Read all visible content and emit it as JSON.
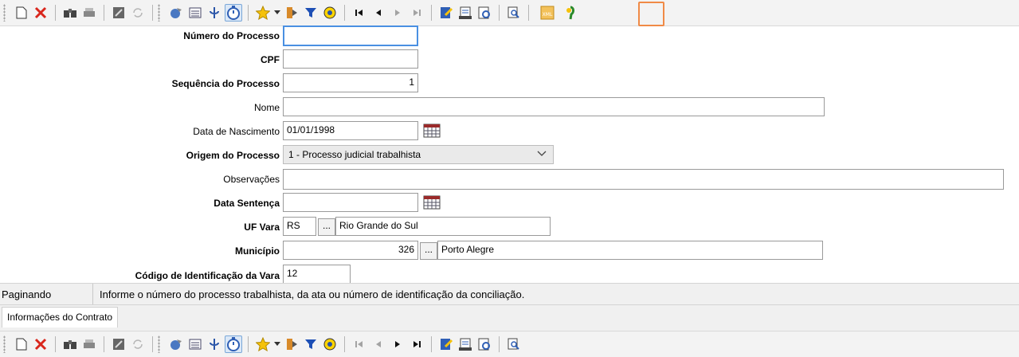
{
  "toolbar_top": {
    "icons": [
      "new-icon",
      "delete-icon",
      "find-icon",
      "print-icon",
      "save-icon",
      "refresh-icon",
      "assistant-icon",
      "list-icon",
      "info-icon",
      "timer-icon",
      "favorites-icon",
      "dropdown-arrow-icon",
      "export-icon",
      "filter-icon",
      "help-icon",
      "first-icon",
      "prev-icon",
      "next-icon",
      "last-icon",
      "edit-icon",
      "report-icon",
      "preview-icon",
      "zoom-icon",
      "xml-icon",
      "tree-icon"
    ],
    "xml_label": "XML"
  },
  "form": {
    "fields": {
      "numero_processo": {
        "label": "Número do Processo",
        "value": ""
      },
      "cpf": {
        "label": "CPF",
        "value": ""
      },
      "sequencia": {
        "label": "Sequência do Processo",
        "value": "1"
      },
      "nome": {
        "label": "Nome",
        "value": ""
      },
      "data_nascimento": {
        "label": "Data de Nascimento",
        "value": "01/01/1998"
      },
      "origem": {
        "label": "Origem do Processo",
        "value": "1 - Processo judicial trabalhista"
      },
      "observacoes": {
        "label": "Observações",
        "value": ""
      },
      "data_sentenca": {
        "label": "Data Sentença",
        "value": ""
      },
      "uf_vara": {
        "label": "UF Vara",
        "code": "RS",
        "name": "Rio Grande do Sul"
      },
      "municipio": {
        "label": "Município",
        "code": "326",
        "name": "Porto Alegre"
      },
      "codigo_vara": {
        "label": "Código de Identificação da Vara",
        "value": "12"
      }
    },
    "lookup_button": "..."
  },
  "status": {
    "mode": "Paginando",
    "hint": "Informe o número do processo trabalhista, da ata ou número de identificação da conciliação."
  },
  "tabs": [
    {
      "label": "Informações do Contrato"
    }
  ],
  "colors": {
    "accent": "#f08a46",
    "focus": "#4a90e2"
  }
}
